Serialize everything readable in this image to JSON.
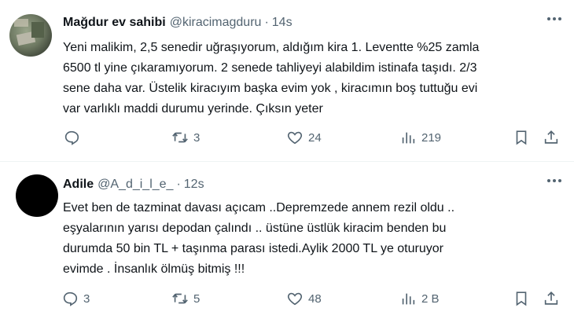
{
  "tweets": [
    {
      "display_name": "Mağdur ev sahibi",
      "handle": "@kiracimagduru",
      "separator": "·",
      "time": "14s",
      "text": "Yeni malikim, 2,5 senedir uğraşıyorum, aldığım kira 1. Leventte %25 zamla\n6500 tl yine çıkaramıyorum. 2 senede tahliyeyi alabildim istinafa taşıdı. 2/3\nsene daha var. Üstelik kiracıyım başka evim yok , kiracımın boş tuttuğu evi\nvar varlıklı maddi durumu yerinde. Çıksın yeter",
      "replies": "",
      "retweets": "3",
      "likes": "24",
      "views": "219"
    },
    {
      "display_name": "Adile",
      "handle": "@A_d_i_l_e_",
      "separator": "·",
      "time": "12s",
      "text": "Evet ben de tazminat davası açıcam ..Depremzede annem rezil oldu ..\neşyalarının yarısı depodan çalındı .. üstüne üstlük kiracim benden bu\ndurumda 50 bin TL + taşınma parası istedi.Aylik 2000 TL ye oturuyor\nevimde . İnsanlık ölmüş bitmiş !!!",
      "replies": "3",
      "retweets": "5",
      "likes": "48",
      "views": "2 B"
    }
  ],
  "icons": {
    "reply": "reply-icon",
    "retweet": "retweet-icon",
    "like": "heart-icon",
    "views": "views-icon",
    "bookmark": "bookmark-icon",
    "share": "share-icon",
    "more": "more-icon"
  },
  "colors": {
    "text": "#0f1419",
    "secondary": "#536471",
    "divider": "#eff3f4"
  }
}
